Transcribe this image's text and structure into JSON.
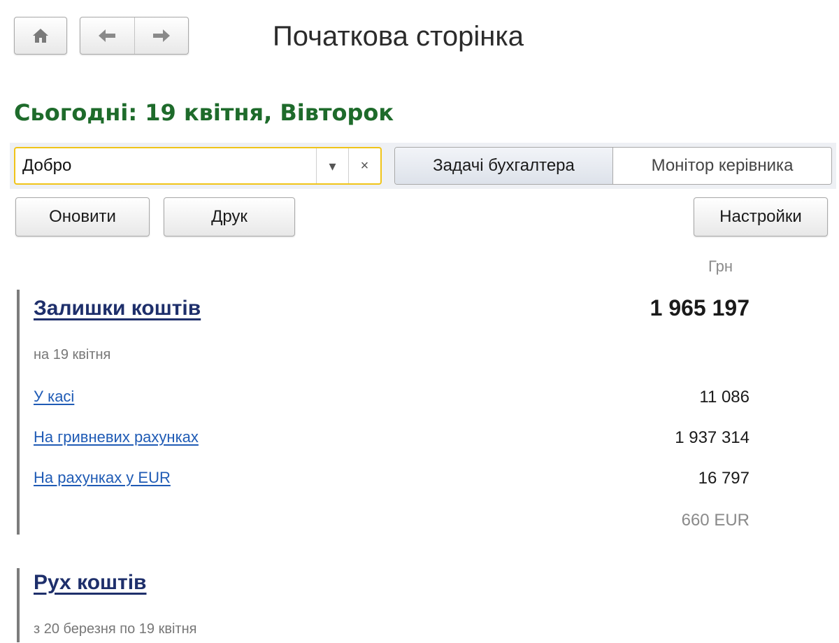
{
  "toolbar": {
    "home_icon": "home-icon",
    "back_icon": "arrow-left-icon",
    "forward_icon": "arrow-right-icon"
  },
  "page": {
    "title": "Початкова сторінка",
    "today": "Сьогодні: 19 квітня, Вівторок"
  },
  "filter": {
    "value": "Добро",
    "dropdown_glyph": "▾",
    "clear_glyph": "×"
  },
  "tabs": [
    {
      "label": "Задачі бухгалтера",
      "active": true
    },
    {
      "label": "Монітор керівника",
      "active": false
    }
  ],
  "actions": {
    "refresh_label": "Оновити",
    "print_label": "Друк",
    "settings_label": "Настройки"
  },
  "currency_label": "Грн",
  "balance": {
    "title": "Залишки коштів",
    "total": "1 965 197",
    "subtitle": "на 19 квітня",
    "rows": [
      {
        "label": "У касі",
        "value": "11 086"
      },
      {
        "label": "На гривневих рахунках",
        "value": "1 937 314"
      },
      {
        "label": "На рахунках у EUR",
        "value": "16 797"
      }
    ],
    "eur_value": "660 EUR"
  },
  "flow": {
    "title": "Рух коштів",
    "subtitle": "з 20 березня по 19 квітня"
  },
  "colors": {
    "today_green": "#1e6b2b",
    "section_title": "#1e2f6b",
    "link": "#1f5bb5",
    "focus_border": "#f0c419"
  }
}
